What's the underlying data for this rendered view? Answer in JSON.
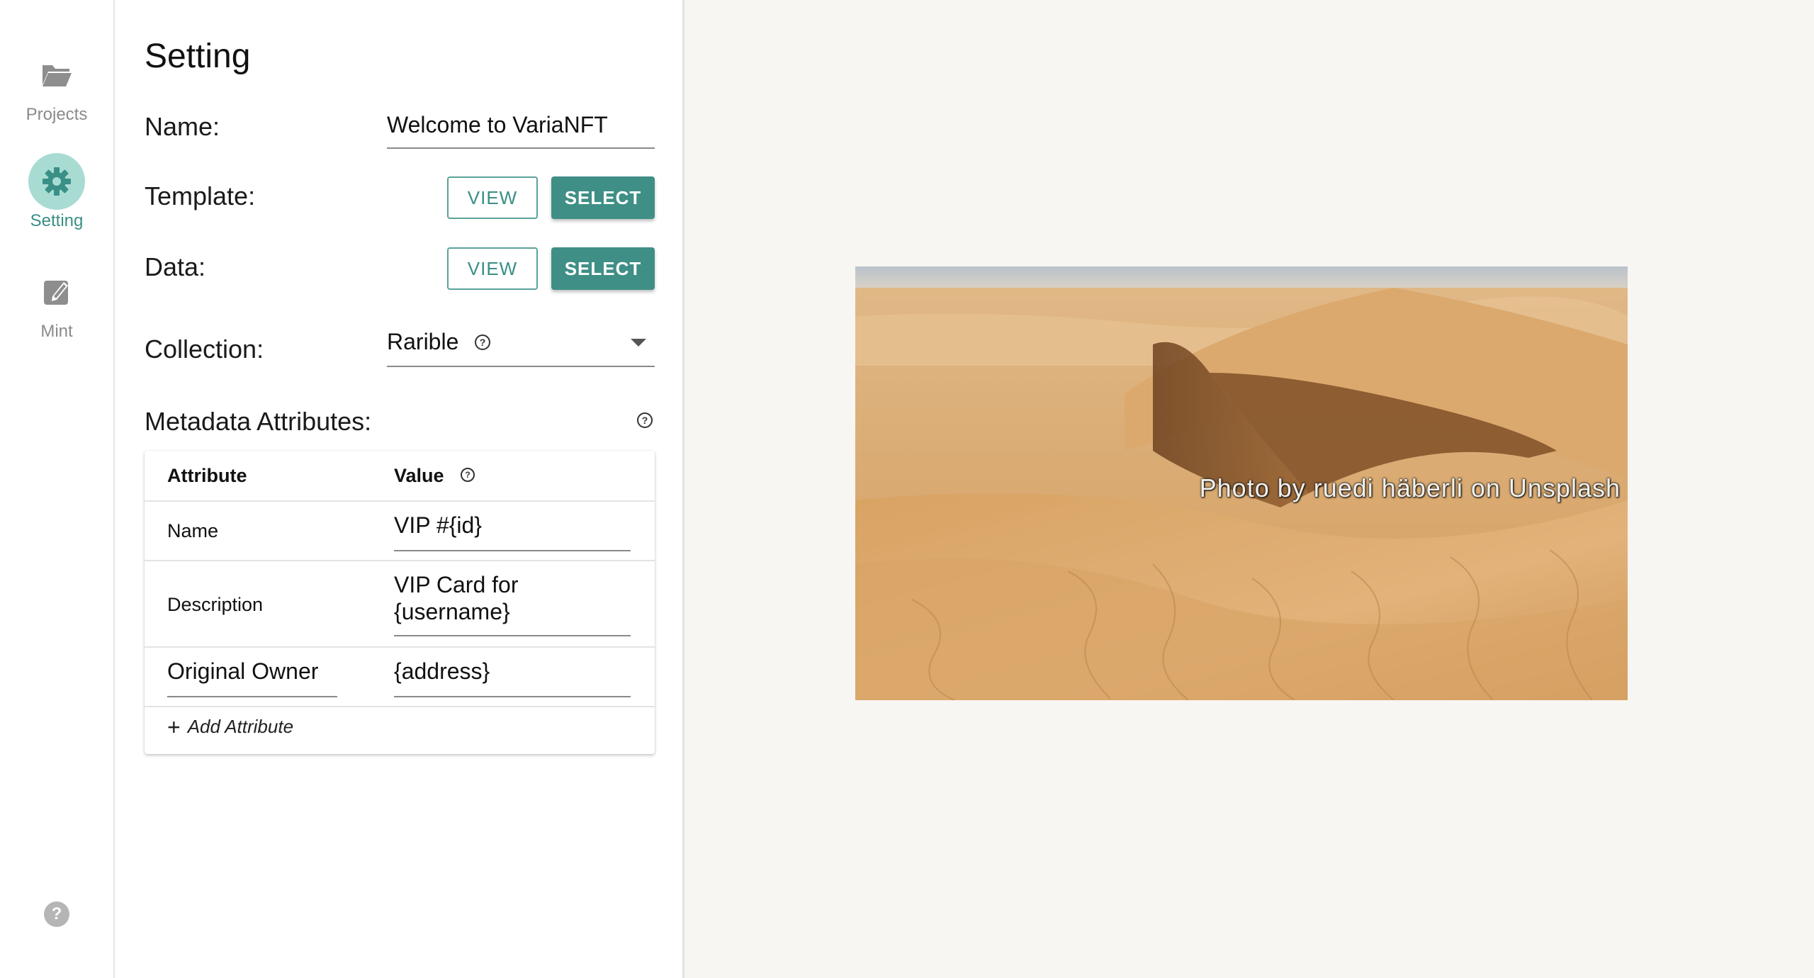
{
  "nav": {
    "items": [
      {
        "label": "Projects",
        "icon": "folder-open-icon",
        "active": false
      },
      {
        "label": "Setting",
        "icon": "gear-icon",
        "active": true
      },
      {
        "label": "Mint",
        "icon": "edit-icon",
        "active": false
      }
    ],
    "help_icon": "help-icon"
  },
  "setting": {
    "title": "Setting",
    "name_label": "Name:",
    "name_value": "Welcome to VariaNFT",
    "template_label": "Template:",
    "data_label": "Data:",
    "view_button": "VIEW",
    "select_button": "SELECT",
    "collection_label": "Collection:",
    "collection_value": "Rarible",
    "metadata_label": "Metadata Attributes:"
  },
  "attributes": {
    "header_attribute": "Attribute",
    "header_value": "Value",
    "rows": [
      {
        "attribute": "Name",
        "value": "VIP #{id}"
      },
      {
        "attribute": "Description",
        "value": "VIP Card for {username}"
      },
      {
        "attribute": "Original Owner",
        "value": "{address}"
      }
    ],
    "add_label": "Add Attribute"
  },
  "preview": {
    "credit": "Photo by ruedi häberli on Unsplash"
  },
  "colors": {
    "accent": "#3f8f86",
    "accent_light": "#a8dcd3",
    "background": "#f7f6f3"
  }
}
